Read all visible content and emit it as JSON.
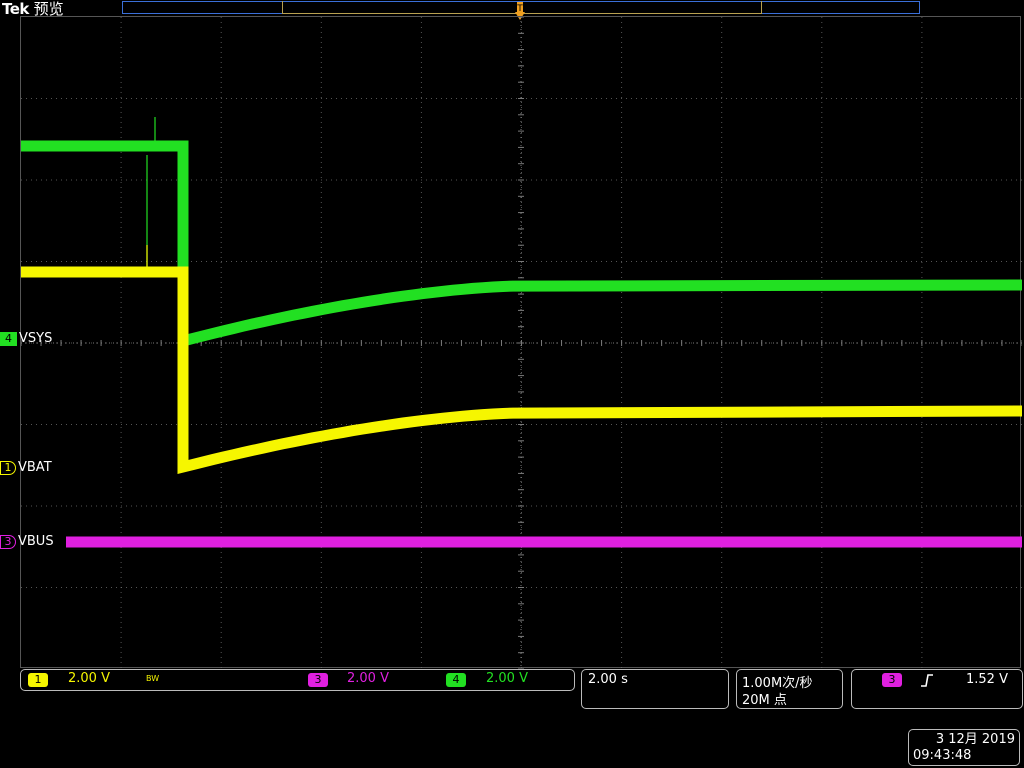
{
  "header": {
    "brand": "Tek",
    "mode": "预览"
  },
  "channels": [
    {
      "num": "4",
      "name": "VSYS",
      "color": "#22e022"
    },
    {
      "num": "1",
      "name": "VBAT",
      "color": "#f6f600"
    },
    {
      "num": "3",
      "name": "VBUS",
      "color": "#e020e0"
    }
  ],
  "vertical": {
    "ch1": {
      "num": "1",
      "scale": "2.00 V",
      "bw": "BW",
      "color": "#f6f600"
    },
    "ch3": {
      "num": "3",
      "scale": "2.00 V",
      "color": "#e020e0"
    },
    "ch4": {
      "num": "4",
      "scale": "2.00 V",
      "color": "#22e022"
    }
  },
  "horizontal": {
    "scale": "2.00 s"
  },
  "acquisition": {
    "rate": "1.00M次/秒",
    "points": "20M 点"
  },
  "trigger": {
    "source": "3",
    "slope": "rising-edge-icon",
    "level": "1.52 V",
    "color": "#e020e0"
  },
  "datetime": {
    "date": "3 12月 2019",
    "time": "09:43:48"
  },
  "colors": {
    "grid": "#7a7a7a",
    "frame": "#555555",
    "accent": "#f0a020"
  }
}
